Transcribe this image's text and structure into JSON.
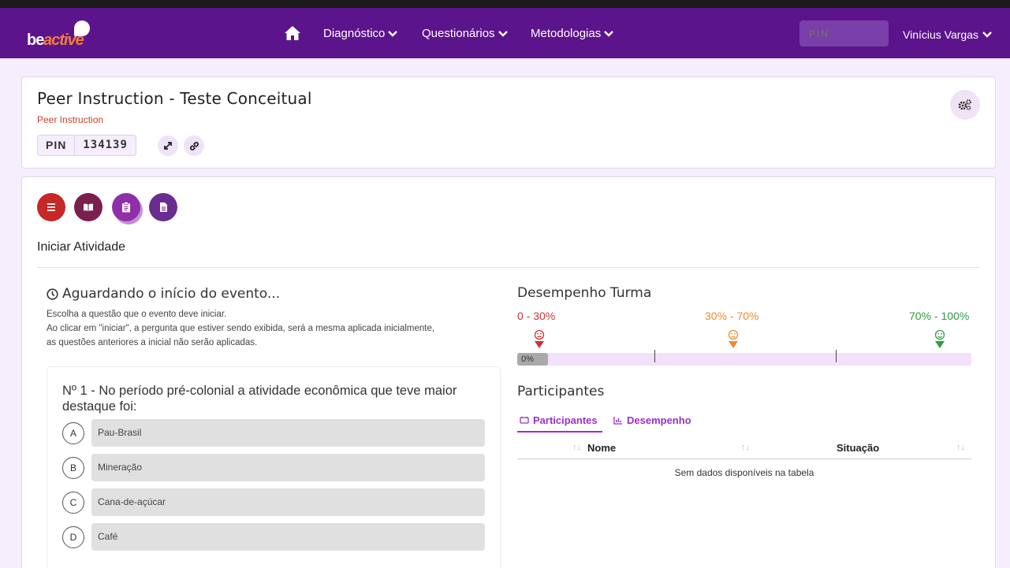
{
  "navbar": {
    "logo_be": "be",
    "logo_active": "active",
    "items": [
      {
        "label": "Diagnóstico"
      },
      {
        "label": "Questionários"
      },
      {
        "label": "Metodologias"
      }
    ],
    "pin_placeholder": "PIN",
    "user_name": "Vinícius Vargas"
  },
  "header": {
    "title": "Peer Instruction - Teste Conceitual",
    "subtitle": "Peer Instruction",
    "pin_label": "PIN",
    "pin_value": "134139"
  },
  "activity": {
    "label": "Iniciar Atividade",
    "buttons": [
      {
        "icon": "list-icon",
        "color": "#c62828"
      },
      {
        "icon": "book-icon",
        "color": "#7b1f4e"
      },
      {
        "icon": "clipboard-icon",
        "color": "#8e2fa8"
      },
      {
        "icon": "file-icon",
        "color": "#6a2c91"
      }
    ]
  },
  "waiting": {
    "title": "Aguardando o início do evento...",
    "lines": [
      "Escolha a questão que o evento deve iniciar.",
      "Ao clicar em \"iniciar\", a pergunta que estiver sendo exibida, será a mesma aplicada inicialmente,",
      "as questões anteriores a inicial não serão aplicadas."
    ]
  },
  "question": {
    "text": "Nº 1 - No período pré-colonial a atividade econômica que teve maior destaque foi:",
    "options": [
      {
        "letter": "A",
        "text": "Pau-Brasil"
      },
      {
        "letter": "B",
        "text": "Mineração"
      },
      {
        "letter": "C",
        "text": "Cana-de-açúcar"
      },
      {
        "letter": "D",
        "text": "Café"
      }
    ]
  },
  "performance": {
    "title": "Desempenho Turma",
    "ranges": [
      {
        "label": "0 - 30%",
        "color": "#d32f2f"
      },
      {
        "label": "30% - 70%",
        "color": "#ef8a2e"
      },
      {
        "label": "70% - 100%",
        "color": "#2e9e3e"
      }
    ],
    "progress_label": "0%",
    "progress_value": 0
  },
  "participants": {
    "title": "Participantes",
    "tabs": [
      {
        "label": "Participantes"
      },
      {
        "label": "Desempenho"
      }
    ],
    "columns": [
      "Nome",
      "Situação"
    ],
    "empty_text": "Sem dados disponíveis na tabela"
  }
}
